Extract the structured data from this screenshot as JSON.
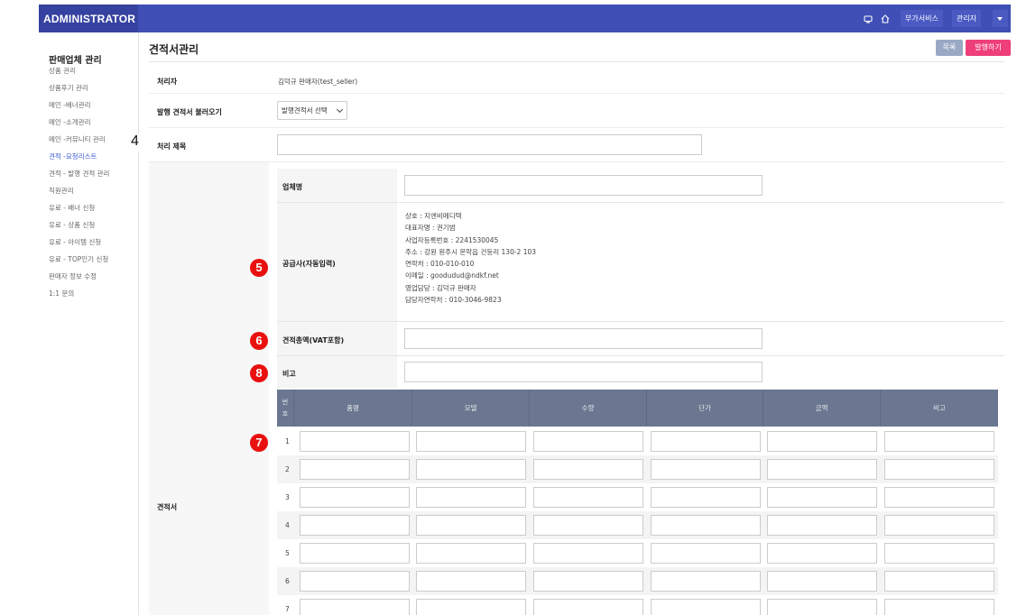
{
  "topbar": {
    "logo": "ADMINISTRATOR",
    "links": [
      "부가서비스",
      "관리자"
    ],
    "accent": "#3f4fb5"
  },
  "sidebar": {
    "title": "판매업체 관리",
    "items": [
      {
        "label": "상품 관리"
      },
      {
        "label": "상품후기 관리"
      },
      {
        "label": "메인 -배너관리"
      },
      {
        "label": "메인 -소개관리"
      },
      {
        "label": "메인 -커뮤니티 관리"
      },
      {
        "label": "견적 -요청리스트",
        "active": true
      },
      {
        "label": "견적 - 발행 견적 관리"
      },
      {
        "label": "직원관리"
      },
      {
        "label": "유료 - 배너 신청"
      },
      {
        "label": "유료 - 상품 신청"
      },
      {
        "label": "유료 - 아이템 신청"
      },
      {
        "label": "유료 - TOP인기 신청"
      },
      {
        "label": "판매자 정보 수정"
      },
      {
        "label": "1:1 문의"
      }
    ]
  },
  "page": {
    "title": "견적서관리",
    "list_button": "목록",
    "issue_button": "발행하기"
  },
  "form": {
    "handler_label": "처리자",
    "handler_value": "김덕규 판매자(test_seller)",
    "load_label": "발행 견적서 불러오기",
    "load_select": "발행견적서 선택",
    "subject_label": "처리 제목",
    "quote_label": "견적서",
    "company_label": "업체명",
    "supplier_label": "공급사(자동입력)",
    "supplier_lines": [
      "상호 : 지엔비메디텍",
      "대표자명 : 권기범",
      "사업자등록번호 : 2241530045",
      "주소 : 강원 원주시 문막읍 건등리 130-2 103",
      "연락처 : 010-010-010",
      "이메일 : goodudud@ndkf.net",
      "영업담당 : 김덕규 판매자",
      "담당자연락처 : 010-3046-9823"
    ],
    "total_label": "견적총액(VAT포함)",
    "note_label": "비고"
  },
  "items_table": {
    "headers": [
      "번호",
      "품명",
      "모델",
      "수량",
      "단가",
      "금액",
      "비고"
    ],
    "rows": [
      "1",
      "2",
      "3",
      "4",
      "5",
      "6",
      "7"
    ]
  },
  "markers": {
    "m4": "4",
    "m5": "5",
    "m6": "6",
    "m8": "8",
    "m7": "7",
    "color": "#e8110f"
  }
}
